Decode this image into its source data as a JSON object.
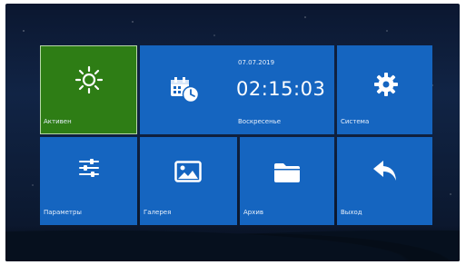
{
  "tiles": {
    "antenna": {
      "label": "Активен",
      "icon": "sun-icon"
    },
    "clock": {
      "date": "07.07.2019",
      "time": "02:15:03",
      "day": "Воскресенье",
      "icon": "calendar-clock-icon"
    },
    "system": {
      "label": "Система",
      "icon": "gear-icon"
    },
    "parameters": {
      "label": "Параметры",
      "icon": "sliders-icon"
    },
    "gallery": {
      "label": "Галерея",
      "icon": "image-icon"
    },
    "files": {
      "label": "Архив",
      "icon": "folder-icon"
    },
    "exit": {
      "label": "Выход",
      "icon": "back-arrow-icon"
    }
  },
  "colors": {
    "tile_blue": "#1565c0",
    "tile_active_green": "#2e7d15",
    "background_night": "#112445"
  }
}
